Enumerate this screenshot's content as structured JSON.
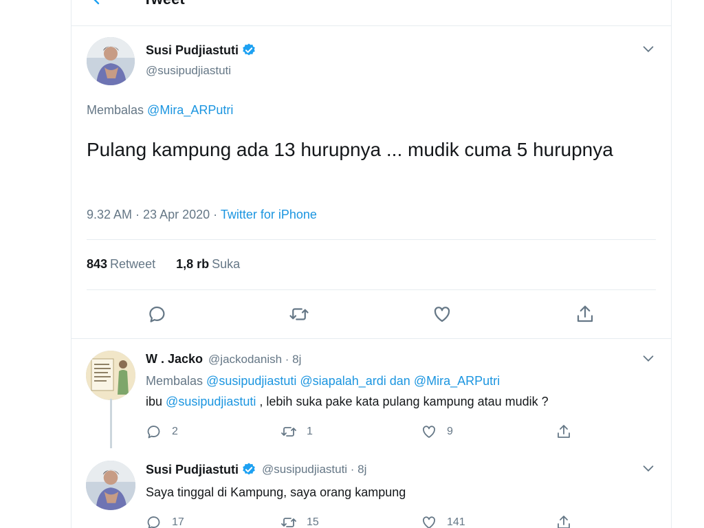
{
  "header": {
    "title": "Tweet"
  },
  "main_tweet": {
    "display_name": "Susi Pudjiastuti",
    "handle": "@susipudjiastuti",
    "reply_prefix": "Membalas",
    "reply_to": "@Mira_ARPutri",
    "text": "Pulang kampung ada 13 hurupnya ... mudik cuma 5 hurupnya",
    "time": "9.32 AM · 23 Apr 2020 ·",
    "source": "Twitter for iPhone",
    "retweets_count": "843",
    "retweets_label": "Retweet",
    "likes_count": "1,8 rb",
    "likes_label": "Suka"
  },
  "replies": [
    {
      "display_name": "W . Jacko",
      "handle_time": "@jackodanish · 8j",
      "reply_prefix": "Membalas",
      "reply_to_1": "@susipudjiastuti",
      "reply_to_2": "@siapalah_ardi",
      "reply_joiner": "dan",
      "reply_to_3": "@Mira_ARPutri",
      "text_prefix": "ibu",
      "text_mention": "@susipudjiastuti",
      "text_rest": ", lebih suka pake kata pulang kampung atau mudik ?",
      "reply_count": "2",
      "retweet_count": "1",
      "like_count": "9"
    },
    {
      "display_name": "Susi Pudjiastuti",
      "handle_time": "@susipudjiastuti · 8j",
      "text": "Saya tinggal di Kampung, saya orang kampung",
      "reply_count": "17",
      "retweet_count": "15",
      "like_count": "141"
    }
  ],
  "colors": {
    "accent": "#1da1f2",
    "link": "#1b95e0",
    "muted": "#657786",
    "border": "#e6ecf0"
  },
  "icons": [
    "back-arrow-icon",
    "verified-icon",
    "chevron-down-icon",
    "reply-icon",
    "retweet-icon",
    "like-icon",
    "share-icon"
  ]
}
